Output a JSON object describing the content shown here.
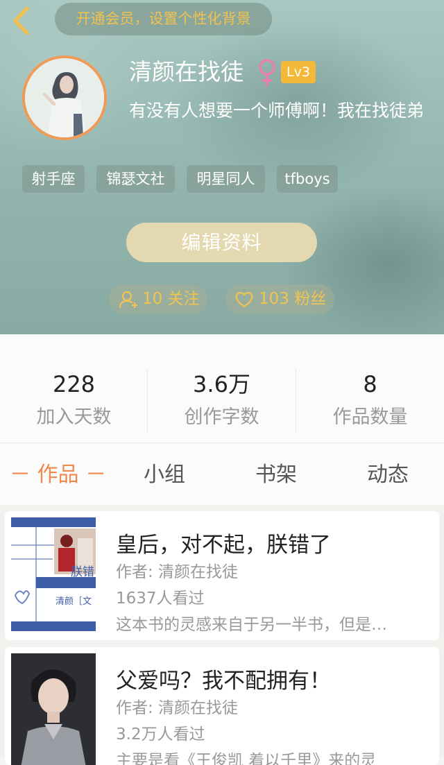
{
  "header": {
    "vip_banner": "开通会员，设置个性化背景",
    "nickname": "清颜在找徒",
    "level": "Lv3",
    "bio": "有没有人想要一个师傅啊！我在找徒弟",
    "tags": [
      "射手座",
      "锦瑟文社",
      "明星同人",
      "tfboys"
    ],
    "edit_button": "编辑资料",
    "follow_label": "10 关注",
    "fans_label": "103 粉丝"
  },
  "stats": [
    {
      "value": "228",
      "label": "加入天数"
    },
    {
      "value": "3.6万",
      "label": "创作字数"
    },
    {
      "value": "8",
      "label": "作品数量"
    }
  ],
  "tabs": {
    "works": "－ 作品 －",
    "group": "小组",
    "bookshelf": "书架",
    "activity": "动态"
  },
  "books": [
    {
      "title": "皇后，对不起，朕错了",
      "author": "作者: 清颜在找徒",
      "views": "1637人看过",
      "desc": "这本书的灵感来自于另一半书，但是…",
      "cover_text_1": "朕错",
      "cover_text_2": "清颜［文"
    },
    {
      "title": "父爱吗？我不配拥有！",
      "author": "作者: 清颜在找徒",
      "views": "3.2万人看过",
      "desc": "主要是看《王俊凯 着以千里》来的灵"
    }
  ],
  "colors": {
    "accent_orange": "#f0874b",
    "gold": "#f3c34f",
    "level_badge": "#f5b93a",
    "female_icon": "#e87fb0"
  }
}
